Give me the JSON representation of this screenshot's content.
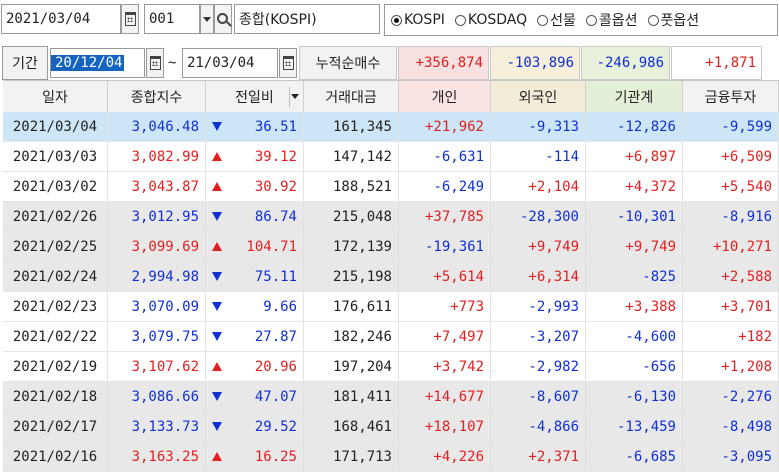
{
  "colors": {
    "up": "#e02020",
    "down": "#1030d0",
    "neutral": "#222222",
    "selected_row_bg": "#cde6f7",
    "band_bg": "#e8e8e8",
    "header_individual_bg": "#f9e3e3",
    "header_foreign_bg": "#f3ecd8",
    "header_institution_bg": "#e4efd8",
    "header_default_bg": "#f2f2f2",
    "sum_individual_bg": "#f9e1e1",
    "sum_foreign_bg": "#f5efdc",
    "sum_institution_bg": "#e7f1dc"
  },
  "toolbar": {
    "date_value": "2021/03/04",
    "code_value": "001",
    "index_name": "종합(KOSPI)",
    "market_options": [
      {
        "label": "KOSPI",
        "selected": true
      },
      {
        "label": "KOSDAQ",
        "selected": false
      },
      {
        "label": "선물",
        "selected": false
      },
      {
        "label": "콜옵션",
        "selected": false
      },
      {
        "label": "풋옵션",
        "selected": false
      }
    ]
  },
  "period": {
    "label": "기간",
    "start": "20/12/04",
    "separator": "~",
    "end": "21/03/04",
    "cumulative_label": "누적순매수",
    "sum_individual": "+356,874",
    "sum_foreign": "-103,896",
    "sum_institution": "-246,986",
    "sum_financial": "+1,871"
  },
  "table": {
    "columns": [
      "일자",
      "종합지수",
      "전일비",
      "거래대금",
      "개인",
      "외국인",
      "기관계",
      "금융투자"
    ],
    "rows": [
      {
        "date": "2021/03/04",
        "index": "3,046.48",
        "dir": "down",
        "change": "36.51",
        "volume": "161,345",
        "individual": "+21,962",
        "foreign": "-9,313",
        "institution": "-12,826",
        "financial": "-9,599"
      },
      {
        "date": "2021/03/03",
        "index": "3,082.99",
        "dir": "up",
        "change": "39.12",
        "volume": "147,142",
        "individual": "-6,631",
        "foreign": "-114",
        "institution": "+6,897",
        "financial": "+6,509"
      },
      {
        "date": "2021/03/02",
        "index": "3,043.87",
        "dir": "up",
        "change": "30.92",
        "volume": "188,521",
        "individual": "-6,249",
        "foreign": "+2,104",
        "institution": "+4,372",
        "financial": "+5,540"
      },
      {
        "date": "2021/02/26",
        "index": "3,012.95",
        "dir": "down",
        "change": "86.74",
        "volume": "215,048",
        "individual": "+37,785",
        "foreign": "-28,300",
        "institution": "-10,301",
        "financial": "-8,916"
      },
      {
        "date": "2021/02/25",
        "index": "3,099.69",
        "dir": "up",
        "change": "104.71",
        "volume": "172,139",
        "individual": "-19,361",
        "foreign": "+9,749",
        "institution": "+9,749",
        "financial": "+10,271"
      },
      {
        "date": "2021/02/24",
        "index": "2,994.98",
        "dir": "down",
        "change": "75.11",
        "volume": "215,198",
        "individual": "+5,614",
        "foreign": "+6,314",
        "institution": "-825",
        "financial": "+2,588"
      },
      {
        "date": "2021/02/23",
        "index": "3,070.09",
        "dir": "down",
        "change": "9.66",
        "volume": "176,611",
        "individual": "+773",
        "foreign": "-2,993",
        "institution": "+3,388",
        "financial": "+3,701"
      },
      {
        "date": "2021/02/22",
        "index": "3,079.75",
        "dir": "down",
        "change": "27.87",
        "volume": "182,246",
        "individual": "+7,497",
        "foreign": "-3,207",
        "institution": "-4,600",
        "financial": "+182"
      },
      {
        "date": "2021/02/19",
        "index": "3,107.62",
        "dir": "up",
        "change": "20.96",
        "volume": "197,204",
        "individual": "+3,742",
        "foreign": "-2,982",
        "institution": "-656",
        "financial": "+1,208"
      },
      {
        "date": "2021/02/18",
        "index": "3,086.66",
        "dir": "down",
        "change": "47.07",
        "volume": "181,411",
        "individual": "+14,677",
        "foreign": "-8,607",
        "institution": "-6,130",
        "financial": "-2,276"
      },
      {
        "date": "2021/02/17",
        "index": "3,133.73",
        "dir": "down",
        "change": "29.52",
        "volume": "168,461",
        "individual": "+18,107",
        "foreign": "-4,866",
        "institution": "-13,459",
        "financial": "-8,498"
      },
      {
        "date": "2021/02/16",
        "index": "3,163.25",
        "dir": "up",
        "change": "16.25",
        "volume": "171,713",
        "individual": "+4,226",
        "foreign": "+2,371",
        "institution": "-6,685",
        "financial": "-3,095"
      }
    ]
  }
}
